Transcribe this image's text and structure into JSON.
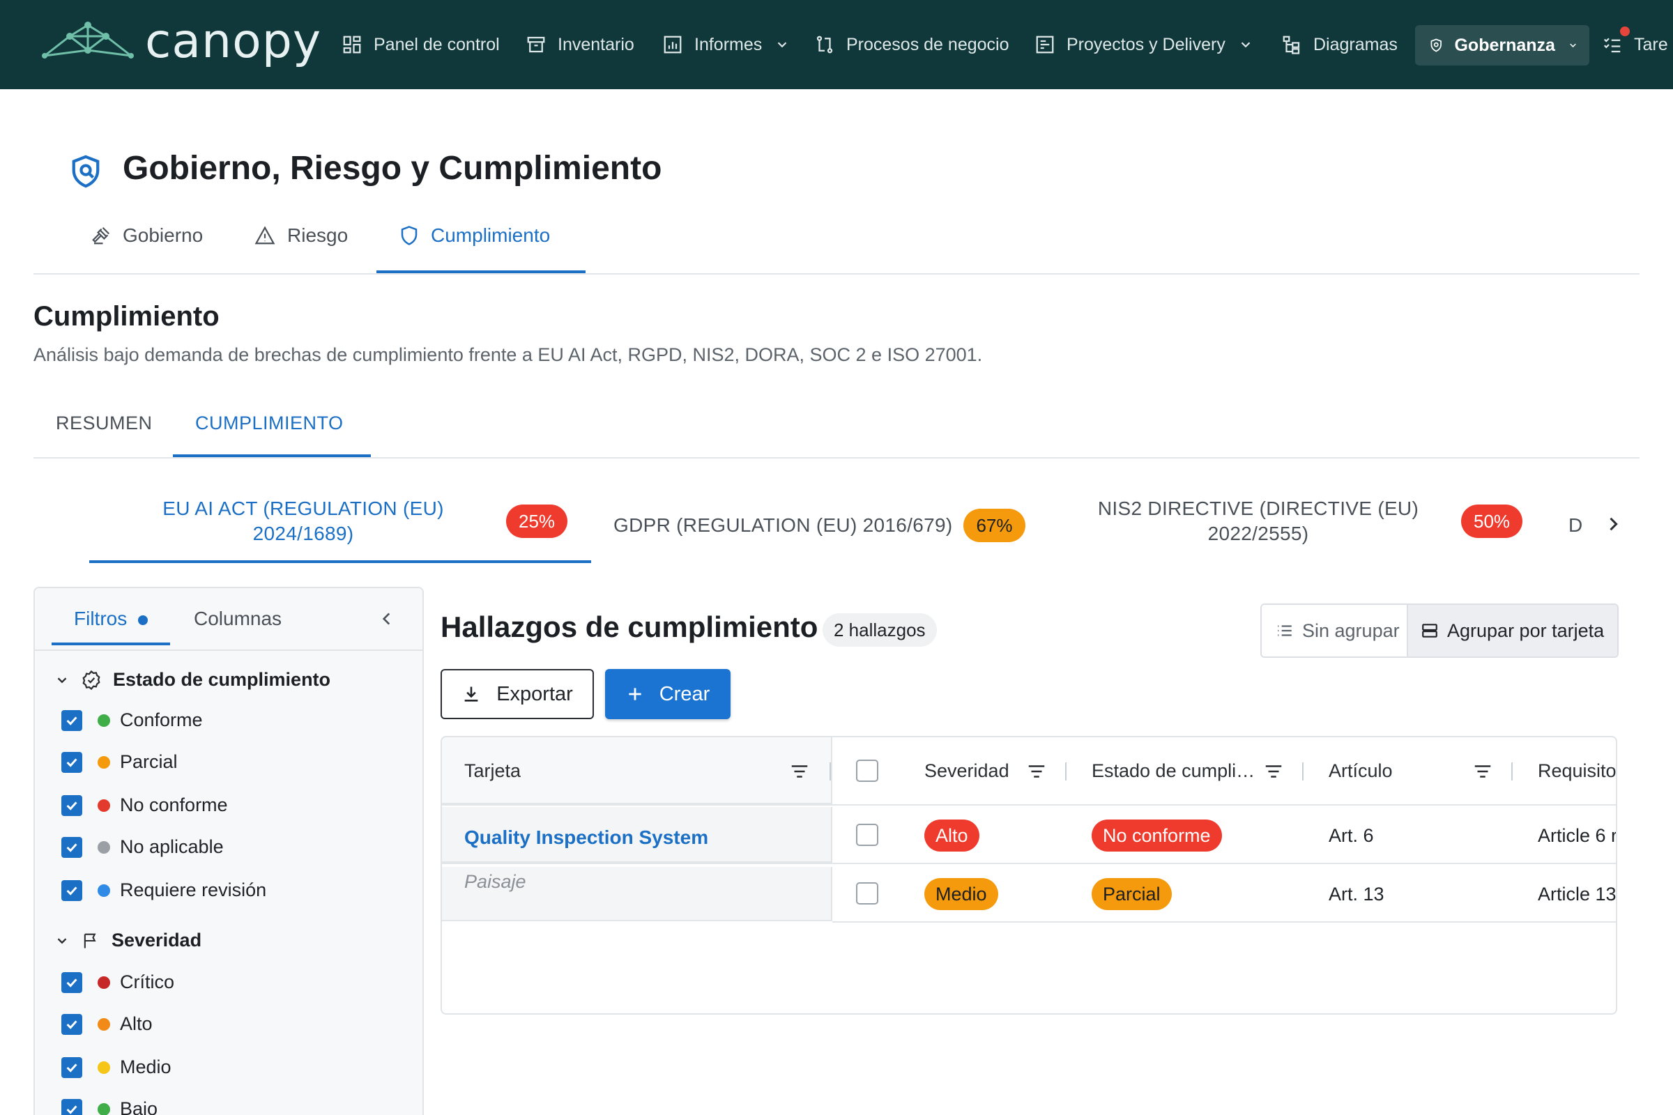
{
  "brand": {
    "name": "canopy"
  },
  "nav": {
    "items": [
      {
        "label": "Panel de control",
        "icon": "dashboard-icon"
      },
      {
        "label": "Inventario",
        "icon": "archive-icon"
      },
      {
        "label": "Informes",
        "icon": "report-chart-icon"
      },
      {
        "label": "Procesos de negocio",
        "icon": "process-flow-icon"
      },
      {
        "label": "Proyectos y Delivery",
        "icon": "projects-icon"
      },
      {
        "label": "Diagramas",
        "icon": "diagram-icon"
      },
      {
        "label": "Gobernanza",
        "icon": "shield-icon"
      },
      {
        "label": "Tare",
        "icon": "task-list-icon"
      }
    ],
    "active": "Gobernanza"
  },
  "page": {
    "title": "Gobierno, Riesgo y Cumplimiento",
    "tabs": [
      {
        "label": "Gobierno",
        "icon": "gavel-icon"
      },
      {
        "label": "Riesgo",
        "icon": "warning-icon"
      },
      {
        "label": "Cumplimiento",
        "icon": "shield-icon"
      }
    ],
    "active_tab": "Cumplimiento"
  },
  "section": {
    "title": "Cumplimiento",
    "description": "Análisis bajo demanda de brechas de cumplimiento frente a EU AI Act, RGPD, NIS2, DORA, SOC 2 e ISO 27001.",
    "subtabs": [
      "RESUMEN",
      "CUMPLIMIENTO"
    ],
    "active_subtab": "CUMPLIMIENTO"
  },
  "frameworks": [
    {
      "line1": "EU AI ACT (REGULATION (EU)",
      "line2": "2024/1689)",
      "score": "25%",
      "color": "#ef3b2d"
    },
    {
      "line1": "GDPR (REGULATION (EU) 2016/679)",
      "line2": "",
      "score": "67%",
      "color": "#f59a0c"
    },
    {
      "line1": "NIS2 DIRECTIVE (DIRECTIVE (EU)",
      "line2": "2022/2555)",
      "score": "50%",
      "color": "#ef3b2d"
    },
    {
      "line1": "D",
      "line2": "",
      "score": "",
      "color": ""
    }
  ],
  "filters": {
    "tabs": [
      "Filtros",
      "Columnas"
    ],
    "groups": [
      {
        "title": "Estado de cumplimiento",
        "options": [
          {
            "label": "Conforme",
            "color": "#3fae49",
            "checked": true
          },
          {
            "label": "Parcial",
            "color": "#f59a0c",
            "checked": true
          },
          {
            "label": "No conforme",
            "color": "#e23b2e",
            "checked": true
          },
          {
            "label": "No aplicable",
            "color": "#9aa0a6",
            "checked": true
          },
          {
            "label": "Requiere revisión",
            "color": "#2f8be6",
            "checked": true
          }
        ]
      },
      {
        "title": "Severidad",
        "options": [
          {
            "label": "Crítico",
            "color": "#c62828",
            "checked": true
          },
          {
            "label": "Alto",
            "color": "#f28a18",
            "checked": true
          },
          {
            "label": "Medio",
            "color": "#f5c518",
            "checked": true
          },
          {
            "label": "Bajo",
            "color": "#3fae49",
            "checked": true
          }
        ]
      }
    ]
  },
  "findings": {
    "title": "Hallazgos de cumplimiento",
    "count": "2 hallazgos",
    "group_none": "Sin agrupar",
    "group_card": "Agrupar por tarjeta",
    "export": "Exportar",
    "create": "Crear",
    "columns": [
      "Tarjeta",
      "Severidad",
      "Estado de cumpli…",
      "Artículo",
      "Requisito"
    ],
    "card": {
      "name": "Quality Inspection System",
      "subtitle": "Paisaje"
    },
    "rows": [
      {
        "severity": "Alto",
        "severity_color": "#ef3b2d",
        "status": "No conforme",
        "status_color": "#ef3b2d",
        "article": "Art. 6",
        "requirement": "Article 6 r"
      },
      {
        "severity": "Medio",
        "severity_color": "#f59a0c",
        "status": "Parcial",
        "status_color": "#f59a0c",
        "article": "Art. 13",
        "requirement": "Article 13"
      }
    ]
  }
}
